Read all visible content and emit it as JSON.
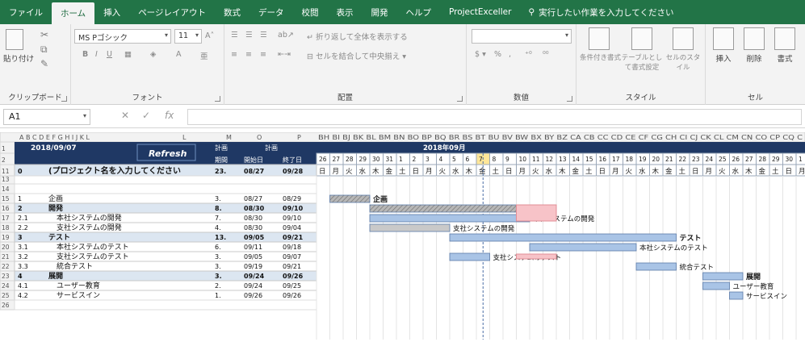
{
  "ribbon_tabs": [
    "ファイル",
    "ホーム",
    "挿入",
    "ページレイアウト",
    "数式",
    "データ",
    "校閲",
    "表示",
    "開発",
    "ヘルプ",
    "ProjectExceller"
  ],
  "active_tab": "ホーム",
  "tell_me": "実行したい作業を入力してください",
  "clipboard": {
    "paste": "貼り付け",
    "label": "クリップボード"
  },
  "font": {
    "name": "MS Pゴシック",
    "size": "11",
    "label": "フォント"
  },
  "alignment": {
    "wrap": "折り返して全体を表示する",
    "merge": "セルを結合して中央揃え",
    "label": "配置"
  },
  "number": {
    "format": "",
    "label": "数値"
  },
  "styles": {
    "conditional": "条件付き書式",
    "table": "テーブルとして書式設定",
    "cell": "セルのスタイル",
    "label": "スタイル"
  },
  "cells": {
    "insert": "挿入",
    "delete": "削除",
    "format": "書式",
    "label": "セル"
  },
  "formula_bar": {
    "name_box": "A1",
    "fx": "fx",
    "value": ""
  },
  "sheet": {
    "row_numbers": [
      "1",
      "2",
      "11",
      "13",
      "14",
      "15",
      "16",
      "17",
      "18",
      "19",
      "20",
      "21",
      "22",
      "23",
      "24",
      "25",
      "26"
    ],
    "col_letters_left": [
      "A",
      "B",
      "C",
      "D",
      "E",
      "F",
      "G",
      "H",
      "I",
      "J",
      "K",
      "L",
      "M",
      "O",
      "P"
    ],
    "date_cell": "2018/09/07",
    "refresh_button": "Refresh",
    "hdr_period": [
      "計画",
      "期間"
    ],
    "hdr_plan": "計画",
    "hdr_start": "開始日",
    "hdr_end": "終了日",
    "timeline_cols": "BH BI BJ BK BL BM BN BO BP BQ BR BS BT BU BV BW BX BY BZ CA CB CC CD CE CF CG CH CI CJ CK CL CM CN CO CP CQ C",
    "month_label": "2018年09月",
    "days": [
      "26",
      "27",
      "28",
      "29",
      "30",
      "31",
      "1",
      "2",
      "3",
      "4",
      "5",
      "6",
      "7",
      "8",
      "9",
      "10",
      "11",
      "12",
      "13",
      "14",
      "15",
      "16",
      "17",
      "18",
      "19",
      "20",
      "21",
      "22",
      "23",
      "24",
      "25",
      "26",
      "27",
      "28",
      "29",
      "30",
      "1"
    ],
    "weekdays": [
      "日",
      "月",
      "火",
      "水",
      "木",
      "金",
      "土",
      "日",
      "月",
      "火",
      "水",
      "木",
      "金",
      "土",
      "日",
      "月",
      "火",
      "水",
      "木",
      "金",
      "土",
      "日",
      "月",
      "火",
      "水",
      "木",
      "金",
      "土",
      "日",
      "月",
      "火",
      "水",
      "木",
      "金",
      "土",
      "日",
      "月"
    ],
    "tasks": [
      {
        "no": "0",
        "name": "(プロジェクト名を入力してください",
        "period": "23.",
        "start": "08/27",
        "end": "09/28",
        "level": 0
      },
      {
        "no": "1",
        "name": "企画",
        "period": "3.",
        "start": "08/27",
        "end": "08/29",
        "level": 1
      },
      {
        "no": "2",
        "name": "開発",
        "period": "8.",
        "start": "08/30",
        "end": "09/10",
        "level": 1
      },
      {
        "no": "2.1",
        "name": "本社システムの開発",
        "period": "7.",
        "start": "08/30",
        "end": "09/10",
        "level": 2
      },
      {
        "no": "2.2",
        "name": "支社システムの開発",
        "period": "4.",
        "start": "08/30",
        "end": "09/04",
        "level": 2
      },
      {
        "no": "3",
        "name": "テスト",
        "period": "13.",
        "start": "09/05",
        "end": "09/21",
        "level": 1
      },
      {
        "no": "3.1",
        "name": "本社システムのテスト",
        "period": "6.",
        "start": "09/11",
        "end": "09/18",
        "level": 2
      },
      {
        "no": "3.2",
        "name": "支社システムのテスト",
        "period": "3.",
        "start": "09/05",
        "end": "09/07",
        "level": 2
      },
      {
        "no": "3.3",
        "name": "統合テスト",
        "period": "3.",
        "start": "09/19",
        "end": "09/21",
        "level": 2
      },
      {
        "no": "4",
        "name": "展開",
        "period": "3.",
        "start": "09/24",
        "end": "09/26",
        "level": 1
      },
      {
        "no": "4.1",
        "name": "ユーザー教育",
        "period": "2.",
        "start": "09/24",
        "end": "09/25",
        "level": 2
      },
      {
        "no": "4.2",
        "name": "サービスイン",
        "period": "1.",
        "start": "09/26",
        "end": "09/26",
        "level": 2
      }
    ],
    "gantt_labels": [
      "企画",
      "開発",
      "本社システムの開発",
      "支社システムの開発",
      "テスト",
      "本社システムのテスト",
      "支社システムのテスト",
      "統合テスト",
      "展開",
      "ユーザー教育",
      "サービスイン"
    ]
  },
  "colors": {
    "ribbon": "#227447",
    "bar": "#a9c4e6",
    "pink": "#f7c3c8",
    "summary_row": "#dce6f1",
    "today": "#ffe699"
  }
}
